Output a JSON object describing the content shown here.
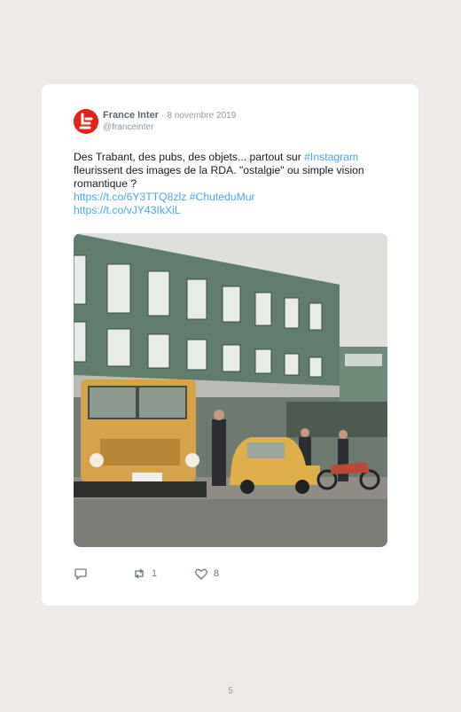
{
  "tweet": {
    "author_name": "France Inter",
    "separator": "·",
    "date": "8 novembre 2019",
    "handle": "@franceinter",
    "text_part1": "Des Trabant, des pubs, des objets... partout sur ",
    "hashtag_instagram": "#Instagram",
    "text_part2": " fleurissent des images de la RDA. \"ostalgie\" ou simple vision romantique ?",
    "link_1": "https://t.co/6Y3TTQ8zlz",
    "hashtag_chute": "#ChuteduMur",
    "link_2": "https://t.co/vJY43IkXiL",
    "image_alt": "Photo d'époque : camion jaune, Trabant et moto devant un bâtiment en RDA",
    "reply_count": "",
    "retweet_count": "1",
    "like_count": "8",
    "avatar_color": "#e2231a",
    "link_color": "#4aa8e8"
  },
  "page": {
    "number": "5"
  }
}
